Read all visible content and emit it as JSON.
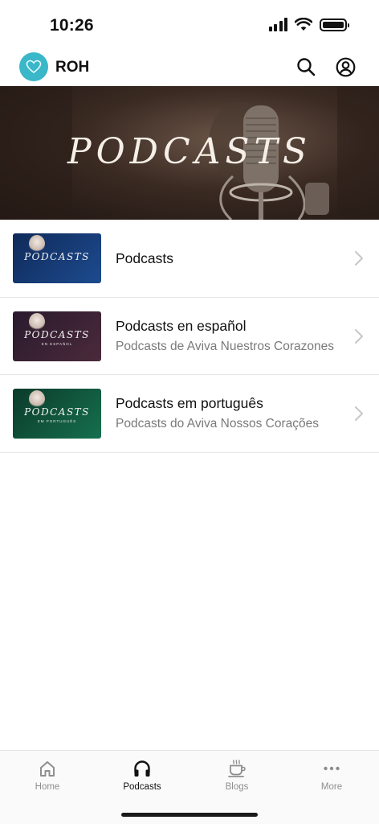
{
  "status_bar": {
    "time": "10:26"
  },
  "header": {
    "app_name": "ROH",
    "brand_color": "#3ab7c8"
  },
  "hero": {
    "title": "PODCASTS"
  },
  "podcasts": [
    {
      "title": "Podcasts",
      "subtitle": "",
      "thumb_word": "PODCASTS",
      "thumb_sub": "",
      "thumb_colors": [
        "#0f2a5a",
        "#1d4b8e"
      ]
    },
    {
      "title": "Podcasts en español",
      "subtitle": "Podcasts de Aviva Nuestros Corazones",
      "thumb_word": "PODCASTS",
      "thumb_sub": "EN ESPAÑOL",
      "thumb_colors": [
        "#2a1a2e",
        "#4a2a3a"
      ]
    },
    {
      "title": "Podcasts em português",
      "subtitle": "Podcasts do Aviva Nossos Corações",
      "thumb_word": "PODCASTS",
      "thumb_sub": "EM PORTUGUÊS",
      "thumb_colors": [
        "#0b3a2a",
        "#16704f"
      ]
    }
  ],
  "nav": [
    {
      "label": "Home",
      "icon": "home-icon",
      "active": false
    },
    {
      "label": "Podcasts",
      "icon": "headphones-icon",
      "active": true
    },
    {
      "label": "Blogs",
      "icon": "coffee-cup-icon",
      "active": false
    },
    {
      "label": "More",
      "icon": "more-dots-icon",
      "active": false
    }
  ]
}
